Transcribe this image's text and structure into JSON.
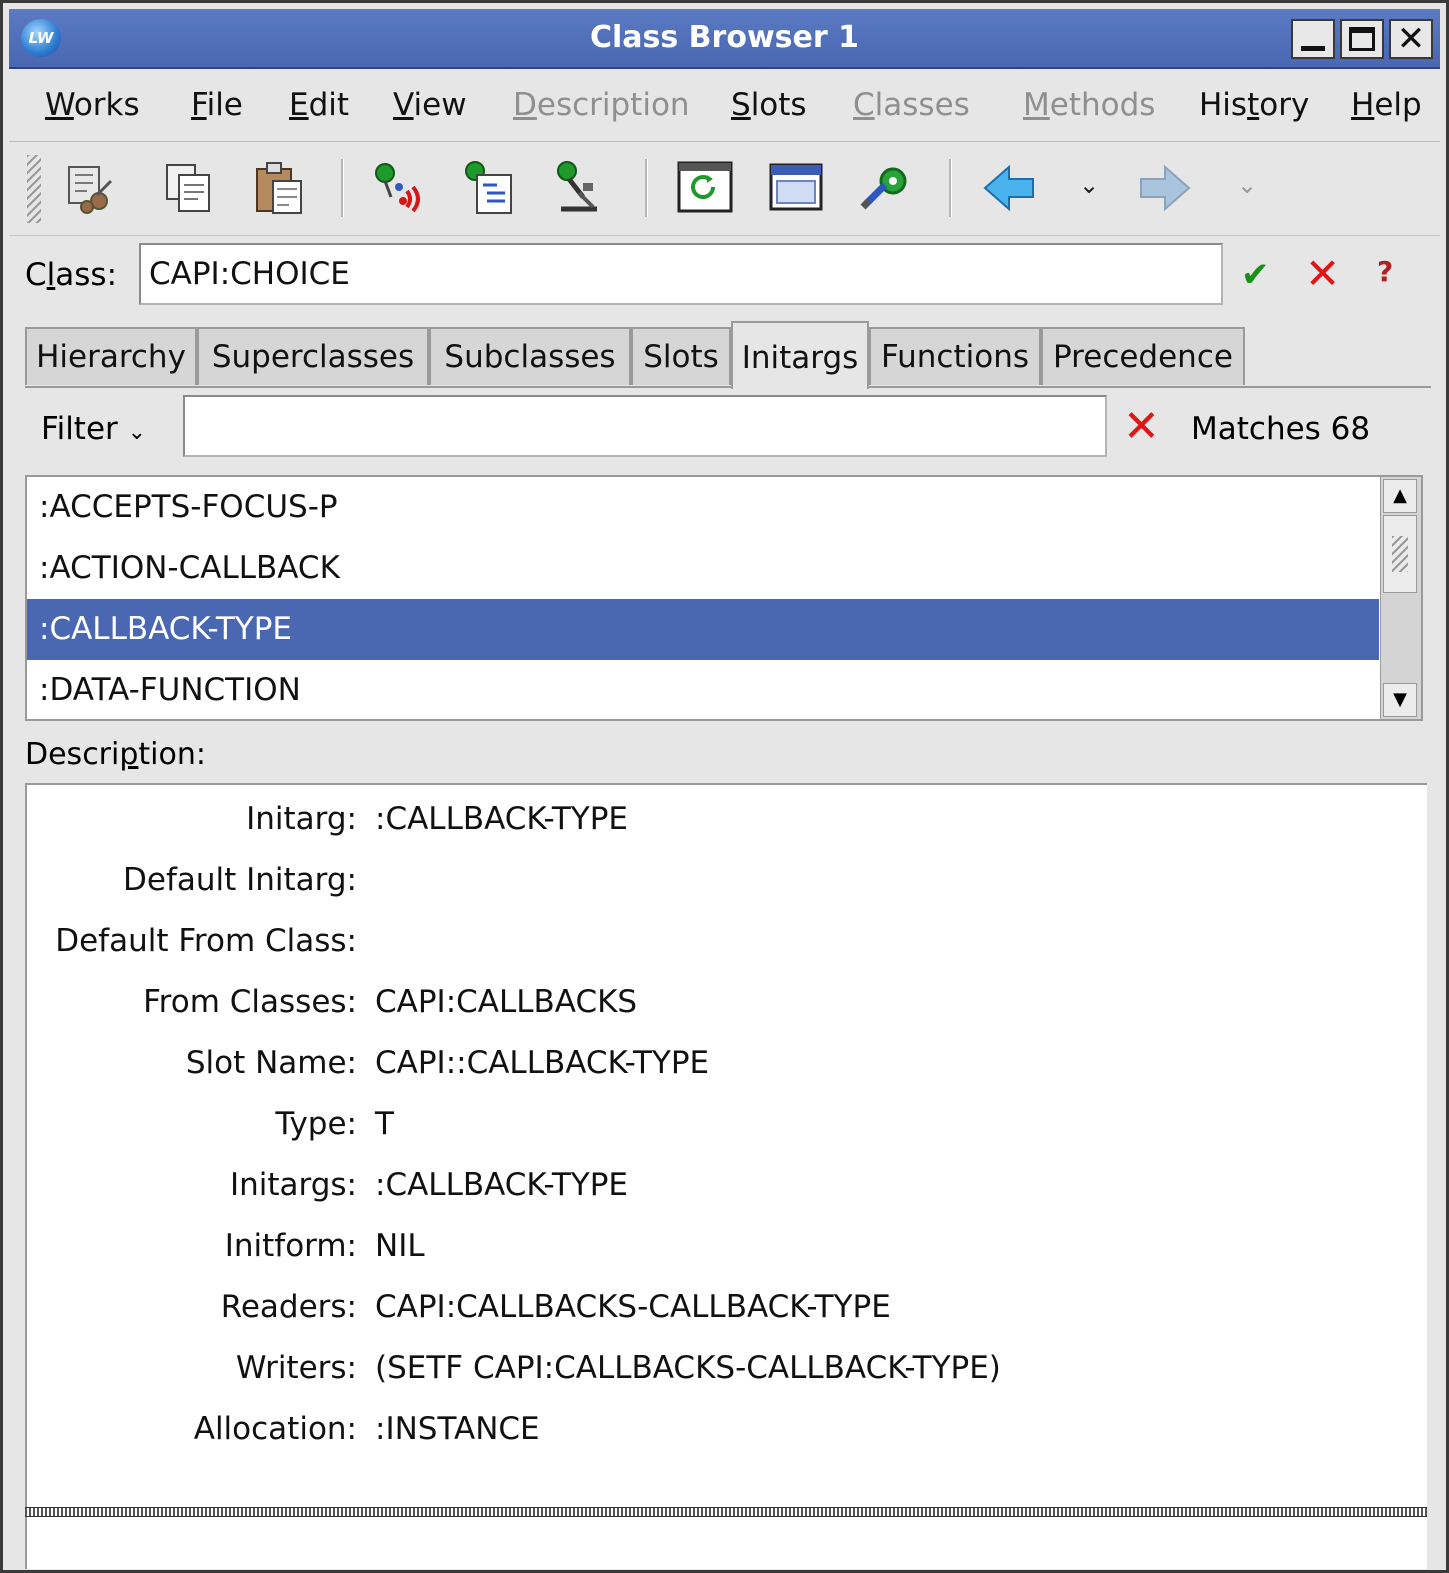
{
  "window": {
    "title": "Class Browser 1",
    "app_icon_text": "LW"
  },
  "menubar": {
    "items": [
      {
        "label": "Works",
        "mnemonic_index": 0,
        "enabled": true
      },
      {
        "label": "File",
        "mnemonic_index": 0,
        "enabled": true
      },
      {
        "label": "Edit",
        "mnemonic_index": 0,
        "enabled": true
      },
      {
        "label": "View",
        "mnemonic_index": 0,
        "enabled": true
      },
      {
        "label": "Description",
        "mnemonic_index": 0,
        "enabled": false
      },
      {
        "label": "Slots",
        "mnemonic_index": 0,
        "enabled": true
      },
      {
        "label": "Classes",
        "mnemonic_index": 0,
        "enabled": false
      },
      {
        "label": "Methods",
        "mnemonic_index": 0,
        "enabled": false
      },
      {
        "label": "History",
        "mnemonic_index": 3,
        "enabled": true
      },
      {
        "label": "Help",
        "mnemonic_index": 0,
        "enabled": true
      }
    ]
  },
  "toolbar": {
    "icons": [
      "cut-icon",
      "copy-icon",
      "paste-icon",
      "inspect-icon",
      "listen-icon",
      "browse-icon",
      "refresh-icon",
      "new-window-icon",
      "preferences-icon",
      "back-icon",
      "forward-icon"
    ]
  },
  "class_field": {
    "label": "Class:",
    "value": "CAPI:CHOICE"
  },
  "tabs": [
    {
      "label": "Hierarchy",
      "active": false
    },
    {
      "label": "Superclasses",
      "active": false
    },
    {
      "label": "Subclasses",
      "active": false
    },
    {
      "label": "Slots",
      "active": false
    },
    {
      "label": "Initargs",
      "active": true
    },
    {
      "label": "Functions",
      "active": false
    },
    {
      "label": "Precedence",
      "active": false
    }
  ],
  "filter": {
    "label": "Filter",
    "value": "",
    "matches_text": "Matches 68"
  },
  "initargs_list": {
    "items": [
      ":ACCEPTS-FOCUS-P",
      ":ACTION-CALLBACK",
      ":CALLBACK-TYPE",
      ":DATA-FUNCTION"
    ],
    "selected_index": 2
  },
  "description": {
    "label": "Description:",
    "rows": [
      {
        "key": "Initarg:",
        "value": ":CALLBACK-TYPE"
      },
      {
        "key": "Default Initarg:",
        "value": ""
      },
      {
        "key": "Default From Class:",
        "value": ""
      },
      {
        "key": "From Classes:",
        "value": "CAPI:CALLBACKS"
      },
      {
        "key": "Slot Name:",
        "value": "CAPI::CALLBACK-TYPE"
      },
      {
        "key": "Type:",
        "value": "T"
      },
      {
        "key": "Initargs:",
        "value": ":CALLBACK-TYPE"
      },
      {
        "key": "Initform:",
        "value": "NIL"
      },
      {
        "key": "Readers:",
        "value": "CAPI:CALLBACKS-CALLBACK-TYPE"
      },
      {
        "key": "Writers:",
        "value": "(SETF CAPI:CALLBACKS-CALLBACK-TYPE)"
      },
      {
        "key": "Allocation:",
        "value": ":INSTANCE"
      }
    ]
  },
  "colors": {
    "title_bar": "#4a67b1",
    "selection": "#4a67b1",
    "ok": "#179217",
    "cancel": "#e01515"
  }
}
